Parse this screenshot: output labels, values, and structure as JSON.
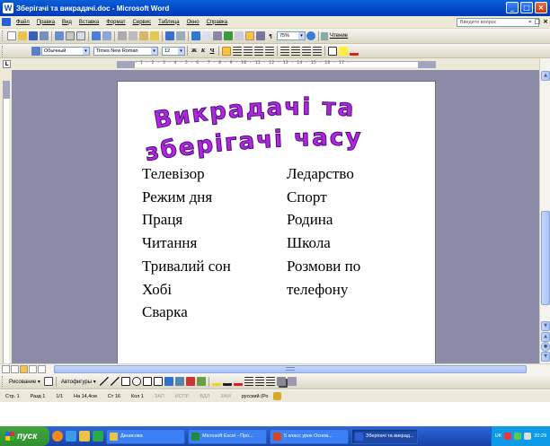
{
  "window": {
    "title": "Зберігачі та викрадачі.doc - Microsoft Word",
    "app_icon_letter": "W",
    "minimize": "_",
    "maximize": "□",
    "close": "×"
  },
  "menu": {
    "items": [
      "Файл",
      "Правка",
      "Вид",
      "Вставка",
      "Формат",
      "Сервис",
      "Таблица",
      "Окно",
      "Справка"
    ],
    "ask_placeholder": "Введите вопрос",
    "doc_controls": [
      "–",
      "□",
      "×"
    ]
  },
  "toolbar_standard": {
    "zoom": "75%",
    "read_button": "Чтение"
  },
  "toolbar_format": {
    "style": "Обычный",
    "font": "Times New Roman",
    "size": "12",
    "bold": "Ж",
    "italic": "К",
    "underline": "Ч"
  },
  "ruler": {
    "ticks": "· 1 · 2 · 3 · 4 · 5 · 6 · 7 · 8 · 9 · 10 · 11 · 12 · 13 · 14 · 15 · 16 · 17 ·",
    "tab_selector": "L"
  },
  "document": {
    "wordart_line1": "Викрадачі та",
    "wordart_line2": "зберігачі часу",
    "left_column": [
      "Телевізор",
      "Режим дня",
      "Праця",
      "Читання",
      "Тривалий сон",
      "Хобі",
      "Сварка"
    ],
    "right_column": [
      "Ледарство",
      "Спорт",
      "Родина",
      "Школа",
      "Розмови по",
      "телефону"
    ]
  },
  "drawing_toolbar": {
    "draw_label": "Рисование ▾",
    "autoshapes_label": "Автофигуры ▾"
  },
  "status": {
    "page": "Стр. 1",
    "section": "Разд 1",
    "pages": "1/1",
    "position": "На 14,4см",
    "line": "Ст 16",
    "column": "Кол 1",
    "rec": "ЗАП",
    "trk": "ИСПР",
    "ext": "ВДЛ",
    "ovr": "ЗАМ",
    "language": "русский (Ро"
  },
  "taskbar": {
    "start": "пуск",
    "tasks": [
      {
        "label": "Денисова",
        "color": "#e8c44a"
      },
      {
        "label": "Microsoft Excel - Про...",
        "color": "#1e8b3a"
      },
      {
        "label": "5 класс урок Основ...",
        "color": "#d24726"
      },
      {
        "label": "Зберігачі та викрад...",
        "color": "#2b5fd8"
      }
    ],
    "lang": "UK",
    "clock": "20:29"
  },
  "colors": {
    "wordart_fill": "#b028d8",
    "wordart_stroke": "#4a0a88",
    "workspace": "#8c8ca8",
    "titlebar": "#0a5fd8"
  }
}
